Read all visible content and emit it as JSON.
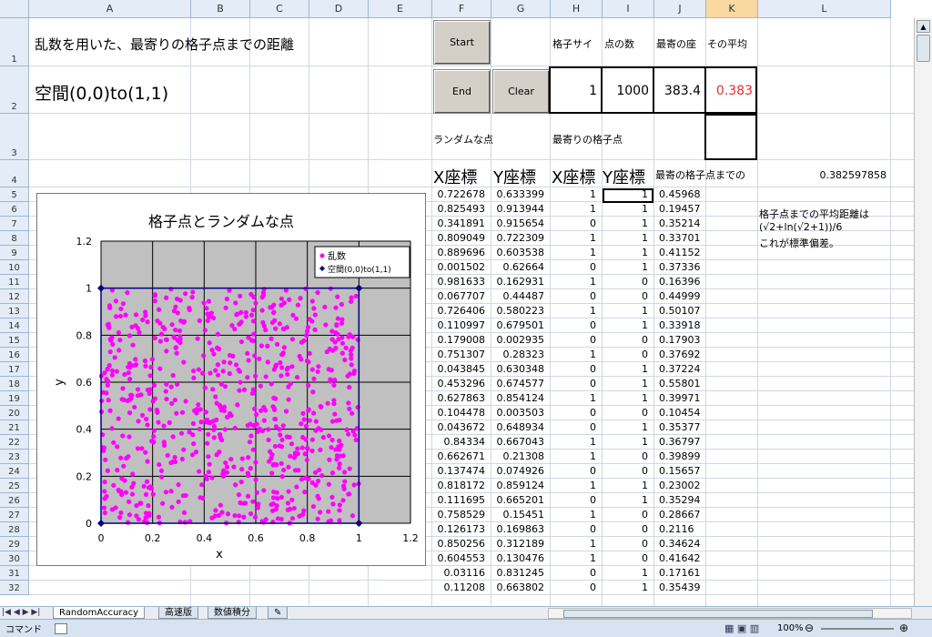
{
  "columns": [
    "A",
    "B",
    "C",
    "D",
    "E",
    "F",
    "G",
    "H",
    "I",
    "J",
    "K",
    "L"
  ],
  "rows": [
    "1",
    "2",
    "3",
    "4",
    "5",
    "6",
    "7",
    "8",
    "9",
    "10",
    "11",
    "12",
    "13",
    "14",
    "15",
    "16",
    "17",
    "18",
    "19",
    "20",
    "21",
    "22",
    "23",
    "24",
    "25",
    "26",
    "27",
    "28",
    "29",
    "30",
    "31",
    "32"
  ],
  "sheet": {
    "title": "乱数を用いた、最寄りの格子点までの距離",
    "space": "空間(0,0)to(1,1)",
    "buttons": {
      "start": "Start",
      "end": "End",
      "clear": "Clear"
    },
    "hdr_h": "格子サイ",
    "hdr_i": "点の数",
    "hdr_j": "最寄の座",
    "hdr_k": "その平均",
    "val_h2": "1",
    "val_i2": "1000",
    "val_j2": "383.4",
    "val_k2": "0.383",
    "random_points": "ランダムな点",
    "nearest_grid": "最寄りの格子点",
    "col_x": "X座標",
    "col_y": "Y座標",
    "col_gx": "X座標",
    "col_gy": "Y座標",
    "col_dist": "最寄の格子点までの",
    "avg_val": "0.382597858",
    "note1": "格子点までの平均距離は",
    "note2": "(√2+ln(√2+1))/6",
    "note3": "これが標準偏差。"
  },
  "table_rows": [
    [
      "0.722678",
      "0.633399",
      "1",
      "1",
      "0.45968"
    ],
    [
      "0.825493",
      "0.913944",
      "1",
      "1",
      "0.19457"
    ],
    [
      "0.341891",
      "0.915654",
      "0",
      "1",
      "0.35214"
    ],
    [
      "0.809049",
      "0.722309",
      "1",
      "1",
      "0.33701"
    ],
    [
      "0.889696",
      "0.603538",
      "1",
      "1",
      "0.41152"
    ],
    [
      "0.001502",
      "0.62664",
      "0",
      "1",
      "0.37336"
    ],
    [
      "0.981633",
      "0.162931",
      "1",
      "0",
      "0.16396"
    ],
    [
      "0.067707",
      "0.44487",
      "0",
      "0",
      "0.44999"
    ],
    [
      "0.726406",
      "0.580223",
      "1",
      "1",
      "0.50107"
    ],
    [
      "0.110997",
      "0.679501",
      "0",
      "1",
      "0.33918"
    ],
    [
      "0.179008",
      "0.002935",
      "0",
      "0",
      "0.17903"
    ],
    [
      "0.751307",
      "0.28323",
      "1",
      "0",
      "0.37692"
    ],
    [
      "0.043845",
      "0.630348",
      "0",
      "1",
      "0.37224"
    ],
    [
      "0.453296",
      "0.674577",
      "0",
      "1",
      "0.55801"
    ],
    [
      "0.627863",
      "0.854124",
      "1",
      "1",
      "0.39971"
    ],
    [
      "0.104478",
      "0.003503",
      "0",
      "0",
      "0.10454"
    ],
    [
      "0.043672",
      "0.648934",
      "0",
      "1",
      "0.35377"
    ],
    [
      "0.84334",
      "0.667043",
      "1",
      "1",
      "0.36797"
    ],
    [
      "0.662671",
      "0.21308",
      "1",
      "0",
      "0.39899"
    ],
    [
      "0.137474",
      "0.074926",
      "0",
      "0",
      "0.15657"
    ],
    [
      "0.818172",
      "0.859124",
      "1",
      "1",
      "0.23002"
    ],
    [
      "0.111695",
      "0.665201",
      "0",
      "1",
      "0.35294"
    ],
    [
      "0.758529",
      "0.15451",
      "1",
      "0",
      "0.28667"
    ],
    [
      "0.126173",
      "0.169863",
      "0",
      "0",
      "0.2116"
    ],
    [
      "0.850256",
      "0.312189",
      "1",
      "0",
      "0.34624"
    ],
    [
      "0.604553",
      "0.130476",
      "1",
      "0",
      "0.41642"
    ],
    [
      "0.03116",
      "0.831245",
      "0",
      "1",
      "0.17161"
    ],
    [
      "0.11208",
      "0.663802",
      "0",
      "1",
      "0.35439"
    ]
  ],
  "chart_data": {
    "type": "scatter",
    "title": "格子点とランダムな点",
    "xlabel": "x",
    "ylabel": "y",
    "xlim": [
      0,
      1.2
    ],
    "ylim": [
      0,
      1.2
    ],
    "xticks": [
      "0",
      "0.2",
      "0.4",
      "0.6",
      "0.8",
      "1",
      "1.2"
    ],
    "yticks": [
      "0",
      "0.2",
      "0.4",
      "0.6",
      "0.8",
      "1",
      "1.2"
    ],
    "plot_bg": "#c0c0c0",
    "legend_position": "top-right",
    "series": [
      {
        "name": "乱数",
        "color": "#ff00ff",
        "marker": "circle",
        "points": [
          [
            0.722678,
            0.633399
          ],
          [
            0.825493,
            0.913944
          ],
          [
            0.341891,
            0.915654
          ],
          [
            0.809049,
            0.722309
          ],
          [
            0.889696,
            0.603538
          ],
          [
            0.001502,
            0.62664
          ],
          [
            0.981633,
            0.162931
          ],
          [
            0.067707,
            0.44487
          ],
          [
            0.726406,
            0.580223
          ],
          [
            0.110997,
            0.679501
          ],
          [
            0.179008,
            0.002935
          ],
          [
            0.751307,
            0.28323
          ],
          [
            0.043845,
            0.630348
          ],
          [
            0.453296,
            0.674577
          ],
          [
            0.627863,
            0.854124
          ],
          [
            0.104478,
            0.003503
          ],
          [
            0.043672,
            0.648934
          ],
          [
            0.84334,
            0.667043
          ],
          [
            0.662671,
            0.21308
          ],
          [
            0.137474,
            0.074926
          ],
          [
            0.818172,
            0.859124
          ],
          [
            0.111695,
            0.665201
          ],
          [
            0.758529,
            0.15451
          ],
          [
            0.126173,
            0.169863
          ],
          [
            0.850256,
            0.312189
          ],
          [
            0.604553,
            0.130476
          ],
          [
            0.03116,
            0.831245
          ],
          [
            0.11208,
            0.663802
          ]
        ]
      },
      {
        "name": "空間(0,0)to(1,1)",
        "color": "#000080",
        "marker": "diamond",
        "points": [
          [
            0,
            0
          ],
          [
            1,
            0
          ],
          [
            1,
            1
          ],
          [
            0,
            1
          ]
        ]
      }
    ]
  },
  "tabs": [
    "RandomAccuracy",
    "高速版",
    "数値積分"
  ],
  "status": {
    "mode": "コマンド",
    "zoom": "100%"
  }
}
